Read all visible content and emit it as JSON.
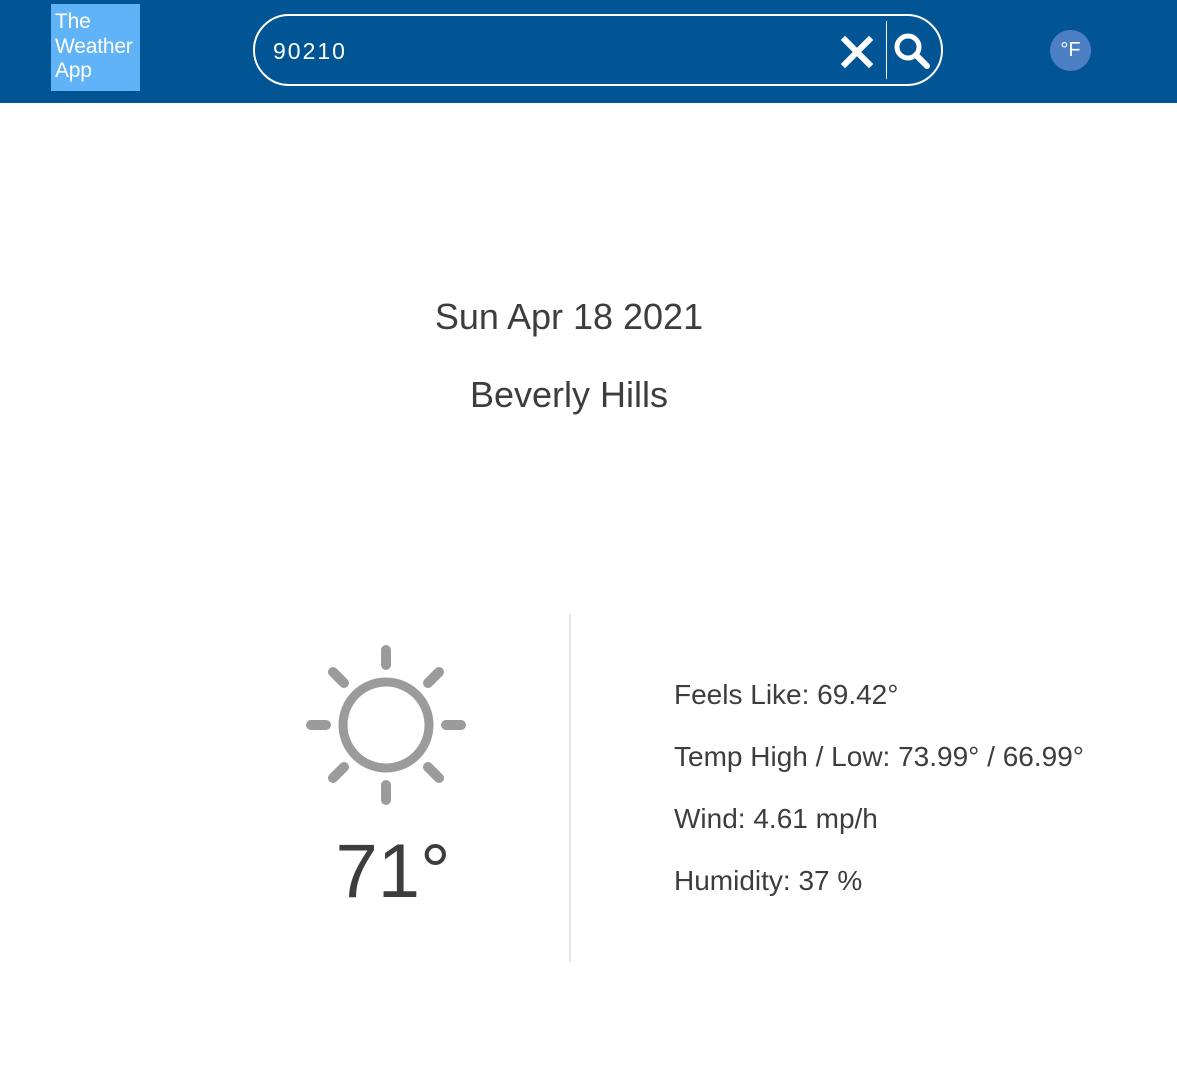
{
  "header": {
    "logo_lines": [
      "The",
      "Weather",
      "App"
    ],
    "search": {
      "value": "90210"
    },
    "unit_toggle": "°F"
  },
  "main": {
    "date": "Sun Apr 18 2021",
    "city": "Beverly Hills",
    "current_temp": "71°",
    "weather_icon": "sun-icon",
    "details": [
      "Feels Like: 69.42°",
      "Temp High / Low: 73.99° / 66.99°",
      "Wind: 4.61 mp/h",
      "Humidity: 37 %"
    ]
  },
  "colors": {
    "header_bg": "#025594",
    "logo_bg": "#61b3f8",
    "toggle_bg": "#4d7fc4",
    "text": "#3d3d3d",
    "icon": "#9b9b9b"
  }
}
